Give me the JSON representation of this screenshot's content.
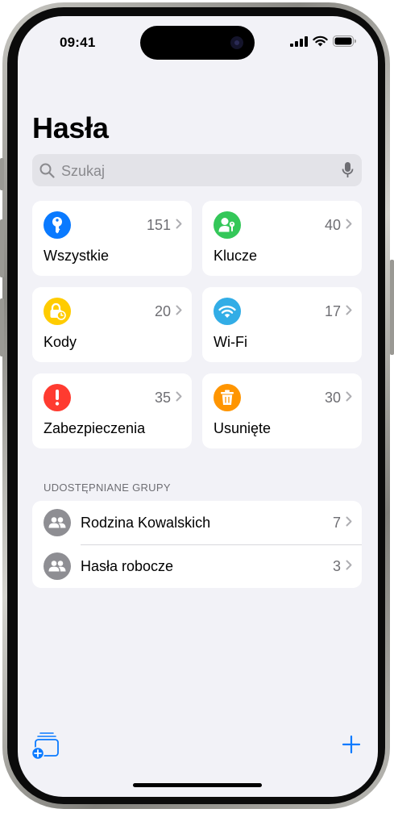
{
  "status_bar": {
    "time": "09:41"
  },
  "header": {
    "title": "Hasła"
  },
  "search": {
    "placeholder": "Szukaj"
  },
  "categories": [
    {
      "label": "Wszystkie",
      "count": "151",
      "icon": "key-icon",
      "color": "#0a7aff"
    },
    {
      "label": "Klucze",
      "count": "40",
      "icon": "person-key-icon",
      "color": "#34c759"
    },
    {
      "label": "Kody",
      "count": "20",
      "icon": "lock-clock-icon",
      "color": "#ffcc00"
    },
    {
      "label": "Wi-Fi",
      "count": "17",
      "icon": "wifi-icon",
      "color": "#32ade6"
    },
    {
      "label": "Zabezpieczenia",
      "count": "35",
      "icon": "exclamation-icon",
      "color": "#ff3b30"
    },
    {
      "label": "Usunięte",
      "count": "30",
      "icon": "trash-icon",
      "color": "#ff9500"
    }
  ],
  "shared_groups": {
    "header": "UDOSTĘPNIANE GRUPY",
    "items": [
      {
        "name": "Rodzina Kowalskich",
        "count": "7"
      },
      {
        "name": "Hasła robocze",
        "count": "3"
      }
    ]
  },
  "toolbar": {
    "new_group_icon": "new-group-icon",
    "add_icon": "plus-icon"
  },
  "colors": {
    "accent": "#0a7aff",
    "background": "#f2f2f7"
  }
}
